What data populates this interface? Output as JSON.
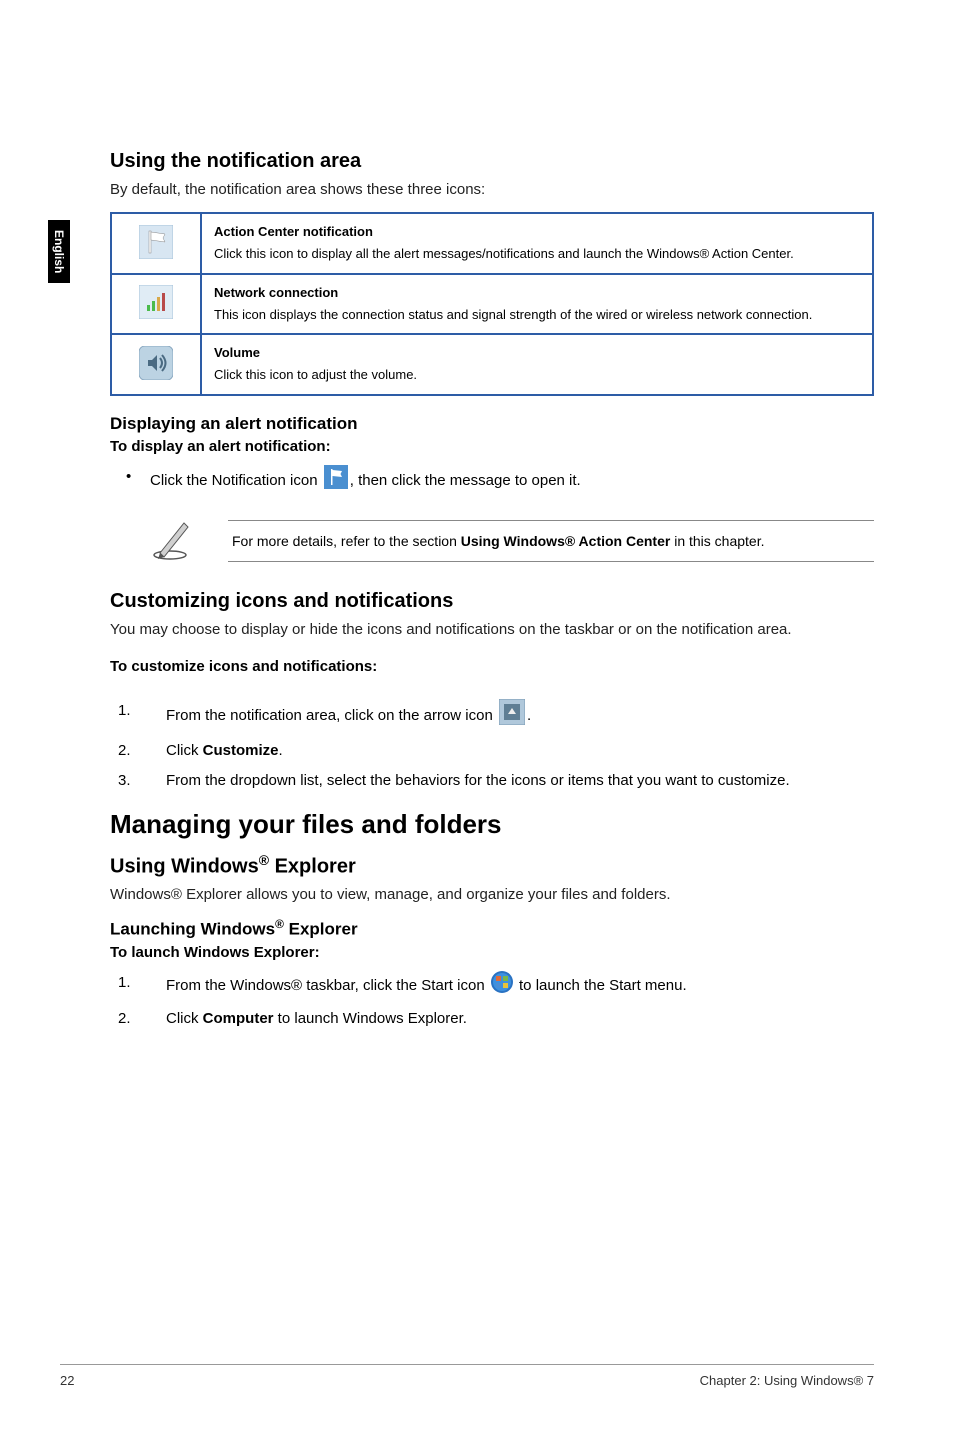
{
  "sidebar": {
    "lang": "English"
  },
  "sec1": {
    "heading": "Using the notification area",
    "intro": "By default, the notification area shows these three icons:",
    "rows": [
      {
        "iconName": "flag-icon",
        "title": "Action Center notification",
        "desc": "Click this icon to display all the alert messages/notifications and launch the Windows® Action Center."
      },
      {
        "iconName": "network-icon",
        "title": "Network connection",
        "desc": "This icon displays the connection status and signal strength of the wired or wireless network connection."
      },
      {
        "iconName": "volume-icon",
        "title": "Volume",
        "desc": "Click this icon to adjust the volume."
      }
    ]
  },
  "sec2": {
    "heading": "Displaying an alert notification",
    "bold": "To display an alert notification:",
    "bullet_pre": "Click the Notification icon ",
    "bullet_post": ", then click the message to open it."
  },
  "note": {
    "pre": "For more details, refer to the section ",
    "bold": "Using Windows® Action Center",
    "post": " in this chapter."
  },
  "sec3": {
    "heading": "Customizing icons and notifications",
    "intro": "You may choose to display or hide the icons and notifications on the taskbar or on the notification area.",
    "bold": "To customize icons and notifications:",
    "items": [
      {
        "pre": "From the notification area, click on the arrow icon ",
        "hasIcon": true,
        "post": "."
      },
      {
        "pre": "Click ",
        "boldWord": "Customize",
        "post": "."
      },
      {
        "pre": "From the dropdown list, select the behaviors for the icons or items that you want to customize."
      }
    ]
  },
  "big": {
    "heading": "Managing your files and folders"
  },
  "sec4": {
    "heading": "Using Windows® Explorer",
    "intro": "Windows® Explorer allows you to view, manage, and organize your files and folders.",
    "sub": "Launching Windows® Explorer",
    "bold": "To launch Windows Explorer:",
    "items": [
      {
        "pre": "From the Windows® taskbar, click the Start icon ",
        "hasIcon": true,
        "post": " to launch the Start menu."
      },
      {
        "pre": "Click ",
        "boldWord": "Computer",
        "post": " to launch Windows Explorer."
      }
    ]
  },
  "footer": {
    "pageNum": "22",
    "chapter": "Chapter 2: Using Windows® 7"
  }
}
